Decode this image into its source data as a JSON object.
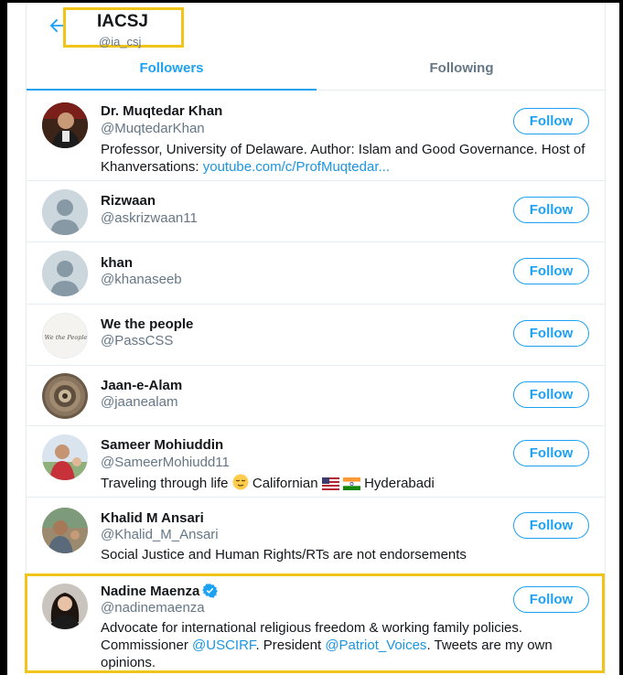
{
  "header": {
    "name": "IACSJ",
    "handle": "@ia_csj",
    "back_icon": "arrow-left-icon"
  },
  "tabs": [
    {
      "label": "Followers",
      "active": true
    },
    {
      "label": "Following",
      "active": false
    }
  ],
  "colors": {
    "accent": "#1da1f2",
    "highlight": "#f0c419",
    "secondary_text": "#657786"
  },
  "follow_label": "Follow",
  "users": [
    {
      "name": "Dr. Muqtedar Khan",
      "handle": "@MuqtedarKhan",
      "bio_text": "Professor, University of Delaware. Author: Islam and Good Governance. Host of Khanversations: ",
      "bio_link": "youtube.com/c/ProfMuqtedar..."
    },
    {
      "name": "Rizwaan",
      "handle": "@askrizwaan11"
    },
    {
      "name": "khan",
      "handle": "@khanaseeb"
    },
    {
      "name": "We the people",
      "handle": "@PassCSS",
      "avatar_text": "We the People"
    },
    {
      "name": "Jaan-e-Alam",
      "handle": "@jaanealam"
    },
    {
      "name": "Sameer Mohiuddin",
      "handle": "@SameerMohiudd11",
      "bio_part1": "Traveling through life ",
      "bio_part2": " Californian ",
      "bio_part3": " Hyderabadi",
      "bio_emojis": [
        "relieved-face",
        "us-flag",
        "india-flag"
      ]
    },
    {
      "name": "Khalid M Ansari",
      "handle": "@Khalid_M_Ansari",
      "bio": "Social Justice and Human Rights/RTs are not endorsements"
    },
    {
      "name": "Nadine Maenza",
      "handle": "@nadinemaenza",
      "verified": true,
      "bio_part1": "Advocate for international religious freedom & working family policies. Commissioner ",
      "bio_link1": "@USCIRF",
      "bio_part2": ". President ",
      "bio_link2": "@Patriot_Voices",
      "bio_part3": ". Tweets are my own opinions."
    }
  ]
}
